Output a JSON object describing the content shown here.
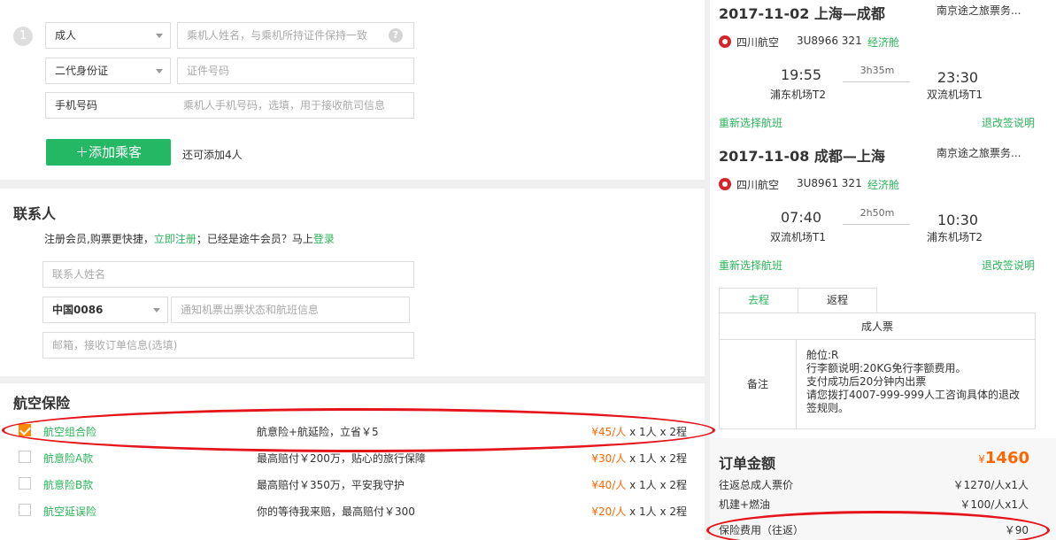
{
  "passenger": {
    "index": "1",
    "type_select": "成人",
    "name_placeholder": "乘机人姓名，与乘机所持证件保持一致",
    "help_icon": "?",
    "id_type_select": "二代身份证",
    "id_placeholder": "证件号码",
    "phone_label": "手机号码",
    "phone_placeholder": "乘机人手机号码，选填，用于接收航司信息",
    "add_button": "添加乘客",
    "add_hint": "还可添加4人"
  },
  "contact": {
    "title": "联系人",
    "hint_before": "注册会员,购票更快捷，",
    "register_link": "立即注册",
    "hint_middle": "；已经是途牛会员？马上",
    "login_link": "登录",
    "name_placeholder": "联系人姓名",
    "country_code": "中国0086",
    "phone_placeholder": "通知机票出票状态和航班信息",
    "email_placeholder": "邮箱，接收订单信息(选填)"
  },
  "insurance": {
    "title": "航空保险",
    "items": [
      {
        "name": "航空组合险",
        "desc": "航意险+航延险，立省￥5",
        "price": "¥45/人",
        "qty": " x 1人 x 2程",
        "checked": true
      },
      {
        "name": "航意险A款",
        "desc": "最高赔付￥200万，贴心的旅行保障",
        "price": "¥30/人",
        "qty": " x 1人 x 2程",
        "checked": false
      },
      {
        "name": "航意险B款",
        "desc": "最高赔付￥350万，平安我守护",
        "price": "¥40/人",
        "qty": " x 1人 x 2程",
        "checked": false
      },
      {
        "name": "航空延误险",
        "desc": "你的等待我来赔，最高赔付￥300",
        "price": "¥20/人",
        "qty": " x 1人 x 2程",
        "checked": false
      }
    ]
  },
  "flights": [
    {
      "date_route": "2017-11-02  上海—成都",
      "agency": "南京途之旅票务...",
      "airline": "四川航空",
      "flight_no": "3U8966",
      "aircraft": "321",
      "cabin": "经济舱",
      "dep_time": "19:55",
      "duration": "3h35m",
      "arr_time": "23:30",
      "dep_airport": "浦东机场T2",
      "arr_airport": "双流机场T1",
      "reselect": "重新选择航班",
      "policy": "退改签说明"
    },
    {
      "date_route": "2017-11-08  成都—上海",
      "agency": "南京途之旅票务...",
      "airline": "四川航空",
      "flight_no": "3U8961",
      "aircraft": "321",
      "cabin": "经济舱",
      "dep_time": "07:40",
      "duration": "2h50m",
      "arr_time": "10:30",
      "dep_airport": "双流机场T1",
      "arr_airport": "浦东机场T2",
      "reselect": "重新选择航班",
      "policy": "退改签说明"
    }
  ],
  "ticket": {
    "tabs": [
      "去程",
      "返程"
    ],
    "header": "成人票",
    "remark_label": "备注",
    "remark_lines": [
      "舱位:R",
      "行李额说明:20KG免行李额费用。",
      "支付成功后20分钟内出票",
      "请您拨打4007-999-999人工咨询具体的退改签规则。"
    ]
  },
  "order": {
    "title": "订单金额",
    "currency": "¥",
    "total": "1460",
    "fees": [
      {
        "label": "往返总成人票价",
        "value": "￥1270/人x1人"
      },
      {
        "label": "机建+燃油",
        "value": "￥100/人x1人"
      },
      {
        "label": "保险费用（往返）",
        "value": "￥90"
      }
    ]
  },
  "colors": {
    "accent_green": "#25b864",
    "link_green": "#2bb55a",
    "price_orange": "#ff6600",
    "annotation_red": "#e5141b"
  }
}
